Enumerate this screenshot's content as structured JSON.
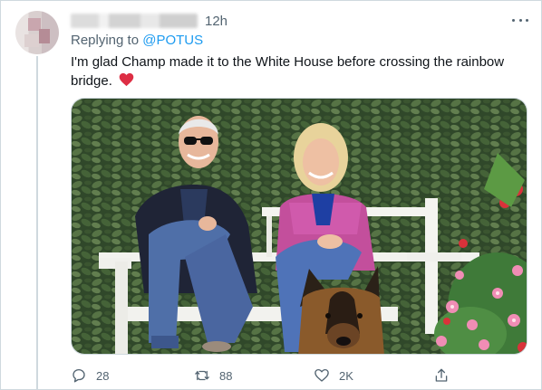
{
  "tweet": {
    "timestamp": "12h",
    "replying_prefix": "Replying to ",
    "replying_to": "@POTUS",
    "text": "I'm glad Champ made it to the White House before crossing the rainbow bridge.",
    "image_alt": "Photo of two people seated on a white bench in a garden with a German Shepherd dog in front"
  },
  "actions": {
    "reply_count": "28",
    "retweet_count": "88",
    "like_count": "2K"
  },
  "colors": {
    "link": "#1d9bf0",
    "secondary_text": "#536471",
    "heart": "#e0245e"
  },
  "icons": {
    "more": "more-horizontal-icon",
    "reply": "reply-icon",
    "retweet": "retweet-icon",
    "like": "heart-outline-icon",
    "share": "share-icon",
    "emoji": "red-heart-emoji"
  }
}
